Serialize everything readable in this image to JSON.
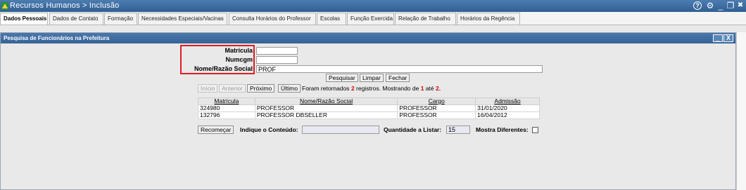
{
  "window": {
    "title": "Recursos Humanos > Inclusão",
    "controls": {
      "help": "?",
      "settings": "⚙",
      "minimize": "_",
      "restore": "❐",
      "close": "✖"
    }
  },
  "tabs": [
    {
      "label": "Dados Pessoais",
      "active": true
    },
    {
      "label": "Dados de Contato"
    },
    {
      "label": "Formação"
    },
    {
      "label": "Necessidades Especiais/Vacinas"
    },
    {
      "label": "Consulta Horários do Professor"
    },
    {
      "label": "Escolas"
    },
    {
      "label": "Função Exercida"
    },
    {
      "label": "Relação de Trabalho"
    },
    {
      "label": "Horários da Regência"
    }
  ],
  "panel": {
    "title": "Pesquisa de Funcionários na Prefeitura",
    "minimize": "_",
    "close": "X"
  },
  "form": {
    "matricula_label": "Matrícula:",
    "matricula_value": "",
    "numcgm_label": "Numcgm:",
    "numcgm_value": "",
    "nome_label": "Nome/Razão Social:",
    "nome_value": "PROF"
  },
  "actions": {
    "pesquisar": "Pesquisar",
    "limpar": "Limpar",
    "fechar": "Fechar"
  },
  "pagination": {
    "inicio": "Início",
    "anterior": "Anterior",
    "proximo": "Próximo",
    "ultimo": "Último",
    "info_prefix": "Foram retornados",
    "count": "2",
    "info_middle": "registros. Mostrando de",
    "from": "1",
    "info_ate": "até",
    "to": "2."
  },
  "results": {
    "headers": [
      "Matrícula",
      "Nome/Razão Social",
      "Cargo",
      "Admissão"
    ],
    "rows": [
      [
        "324980",
        "PROFESSOR",
        "PROFESSOR",
        "31/01/2020"
      ],
      [
        "132796",
        "PROFESSOR DBSELLER",
        "PROFESSOR",
        "16/04/2012"
      ]
    ]
  },
  "filter": {
    "recomecar": "Recomeçar",
    "conteudo_label": "Indique o Conteúdo:",
    "conteudo_value": "",
    "quantidade_label": "Quantidade a Listar:",
    "quantidade_value": "15",
    "mostra_label": "Mostra Diferentes:"
  },
  "colors": {
    "titlebar": "#3b6ba0",
    "highlight": "#e01b24",
    "count_red": "#d40000"
  }
}
